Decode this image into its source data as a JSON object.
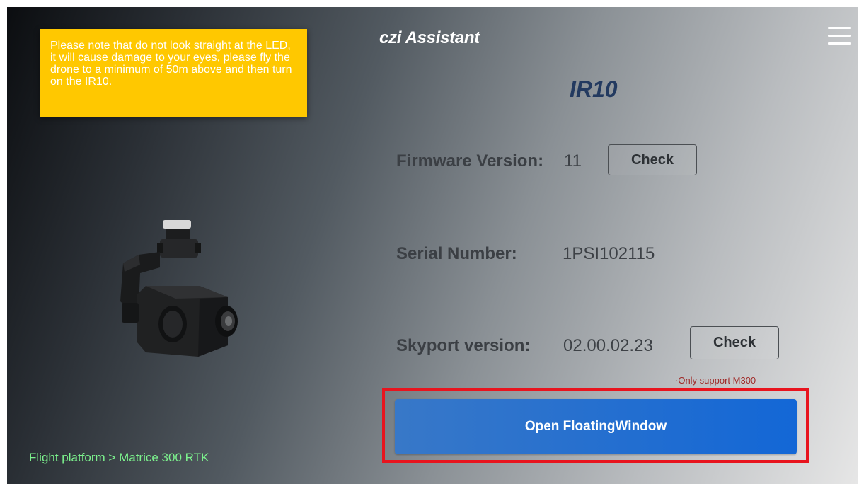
{
  "header": {
    "title": "czi Assistant",
    "menu_icon": "hamburger-menu-icon"
  },
  "warning": {
    "text": "Please note that do not look straight at the LED, it will cause damage to your eyes, please fly the drone to a minimum of 50m above and then turn on the IR10."
  },
  "product": {
    "name": "IR10",
    "image": "gimbal-camera"
  },
  "firmware": {
    "label": "Firmware Version:",
    "value": "11",
    "button": "Check"
  },
  "serial": {
    "label": "Serial Number:",
    "value": "1PSI102115"
  },
  "skyport": {
    "label": "Skyport version:",
    "value": "02.00.02.23",
    "button": "Check",
    "note": "·Only support M300"
  },
  "action": {
    "open_floating_window": "Open FloatingWindow"
  },
  "footer": {
    "platform": "Flight platform > Matrice 300 RTK"
  },
  "colors": {
    "warning_bg": "#ffc800",
    "primary": "#1367d6",
    "highlight": "#e8141e",
    "platform_text": "#7cf28d",
    "product_title": "#233a60"
  }
}
